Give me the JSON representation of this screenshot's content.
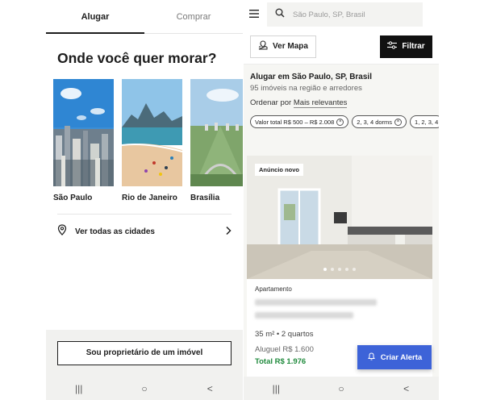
{
  "left": {
    "tabs": [
      {
        "label": "Alugar",
        "active": true
      },
      {
        "label": "Comprar",
        "active": false
      }
    ],
    "headline": "Onde você quer morar?",
    "cities": [
      {
        "name": "São Paulo"
      },
      {
        "name": "Rio de Janeiro"
      },
      {
        "name": "Brasília"
      }
    ],
    "see_all_label": "Ver todas as cidades",
    "owner_button": "Sou proprietário de um imóvel",
    "nav": {
      "recent": "|||",
      "home": "○",
      "back": "<"
    }
  },
  "right": {
    "search_placeholder": "São Paulo, SP, Brasil",
    "map_button": "Ver Mapa",
    "filter_button": "Filtrar",
    "results_title": "Alugar em São Paulo, SP, Brasil",
    "results_count": "95 imóveis na região e arredores",
    "order_prefix": "Ordenar por",
    "order_value": "Mais relevantes",
    "chips": [
      {
        "label": "Valor total R$ 500 – R$ 2.008"
      },
      {
        "label": "2, 3, 4 dorms"
      },
      {
        "label": "1, 2, 3, 4"
      }
    ],
    "listing": {
      "badge": "Anúncio novo",
      "type": "Apartamento",
      "specs": "35 m² • 2 quartos",
      "rent": "Aluguel R$ 1.600",
      "total": "Total R$ 1.976",
      "photo_index": 1,
      "photo_count": 5
    },
    "alert_button": "Criar Alerta",
    "nav": {
      "recent": "|||",
      "home": "○",
      "back": "<"
    }
  },
  "colors": {
    "accent_blue": "#3d63d8",
    "price_green": "#1f8a3c",
    "filter_black": "#111111"
  }
}
